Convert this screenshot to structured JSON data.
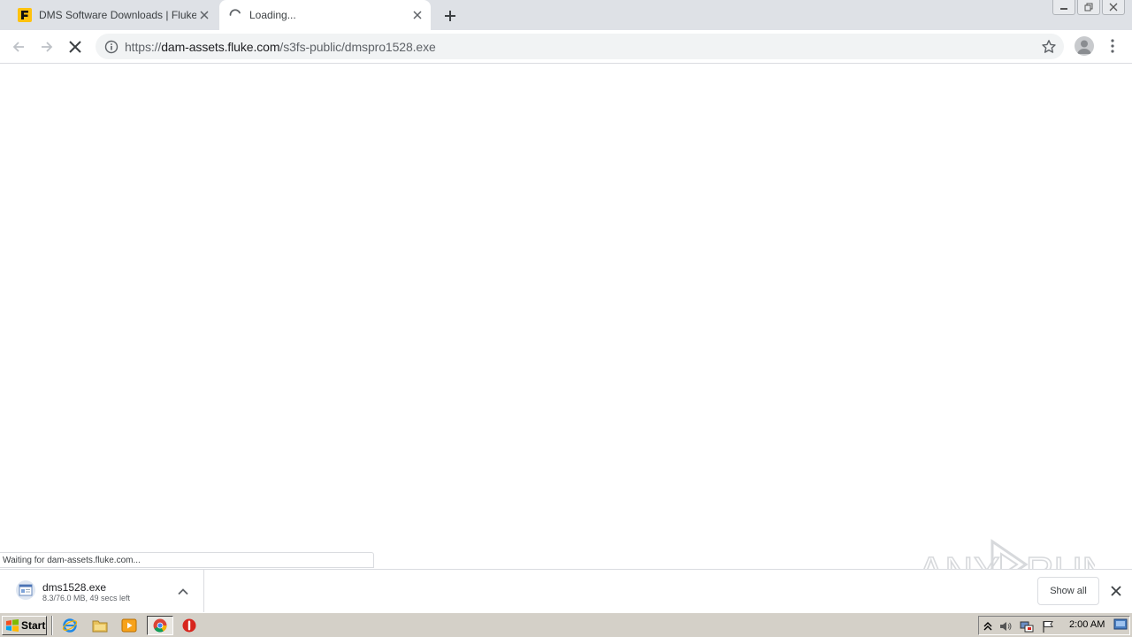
{
  "tabs": [
    {
      "title": "DMS Software Downloads | Fluke",
      "favicon": "fluke-favicon",
      "active": false
    },
    {
      "title": "Loading...",
      "favicon": "loading-spinner",
      "active": true
    }
  ],
  "toolbar": {
    "url_scheme": "https://",
    "url_host": "dam-assets.fluke.com",
    "url_path": "/s3fs-public/dmspro1528.exe",
    "state": "loading"
  },
  "status_bubble": "Waiting for dam-assets.fluke.com...",
  "watermark": "ANY RUN",
  "download": {
    "filename": "dms1528.exe",
    "status": "8.3/76.0 MB, 49 secs left",
    "show_all_label": "Show all"
  },
  "taskbar": {
    "start_label": "Start",
    "quick_launch": [
      "ie-icon",
      "folder-icon",
      "media-player-icon",
      "chrome-icon",
      "stop-icon"
    ],
    "clock": "2:00 AM"
  },
  "colors": {
    "fluke_yellow": "#ffc20e",
    "tabstrip": "#dee1e6",
    "omnibox": "#f1f3f4",
    "taskbar": "#d4d0c8"
  }
}
